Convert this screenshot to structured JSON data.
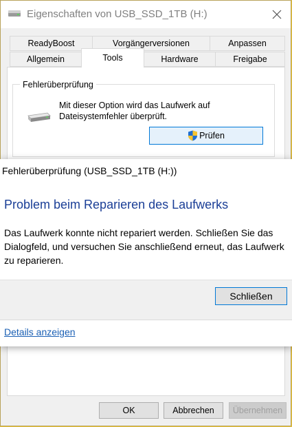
{
  "window": {
    "title": "Eigenschaften von USB_SSD_1TB (H:)"
  },
  "tabs": {
    "row1": [
      "ReadyBoost",
      "Vorgängerversionen",
      "Anpassen"
    ],
    "row2": [
      "Allgemein",
      "Tools",
      "Hardware",
      "Freigabe"
    ],
    "active": "Tools"
  },
  "error_check": {
    "group_title": "Fehlerüberprüfung",
    "description": "Mit dieser Option wird das Laufwerk auf Dateisystemfehler überprüft.",
    "button_label": "Prüfen"
  },
  "footer": {
    "ok_label": "OK",
    "cancel_label": "Abbrechen",
    "apply_label": "Übernehmen"
  },
  "dialog": {
    "title": "Fehlerüberprüfung (USB_SSD_1TB (H:))",
    "heading": "Problem beim Reparieren des Laufwerks",
    "message": "Das Laufwerk konnte nicht repariert werden. Schließen Sie das Dialogfeld, und versuchen Sie anschließend erneut, das Laufwerk zu reparieren.",
    "close_label": "Schließen",
    "details_link": "Details anzeigen"
  },
  "colors": {
    "heading": "#1a3e96",
    "link": "#1a5fb4",
    "accent": "#0078d7",
    "desktop": "#e7c23a"
  }
}
